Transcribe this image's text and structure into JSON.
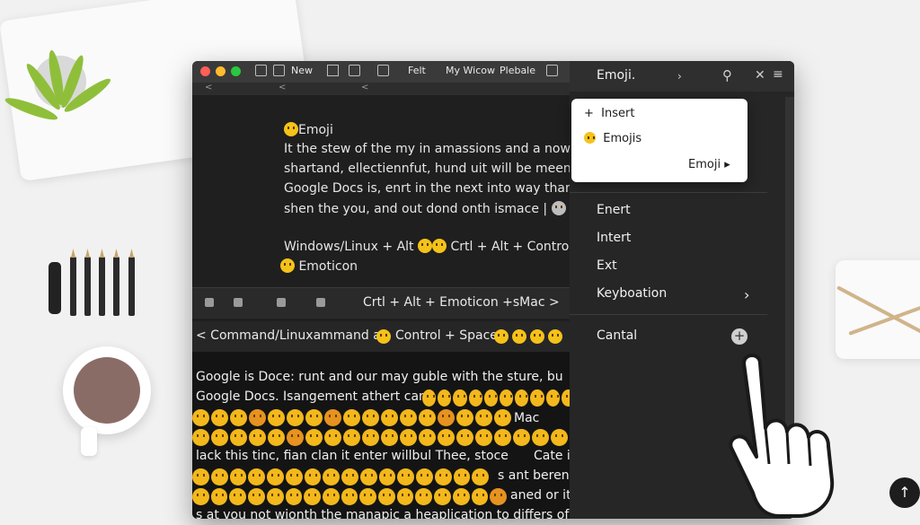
{
  "window": {
    "tabs": [
      "New",
      "Felt",
      "My Wicow",
      "Plebale"
    ],
    "ruler_marks": [
      "<",
      "<",
      "<"
    ]
  },
  "document": {
    "lines": [
      "Emoji",
      "It the stew of the my in amassions and a now on",
      "shartand, ellectiennfut, hund uit will be meenc",
      "Google Docs is, enrt in the next into way than, ybi",
      "shen the you, and out dond onth ismace |",
      "Windows/Linux + Alt",
      "Crtl + Alt + Contro",
      "Emoticon"
    ]
  },
  "toolbar2": {
    "label": "Crtl + Alt + Emoticon +sMac >"
  },
  "band": {
    "label_a": "< Command/Linuxammand at",
    "label_b": "Control + Space"
  },
  "lower": {
    "lines": [
      "Google is Doce: runt and our may guble with the sture, bu",
      "Google Docs. Isangement athert can",
      "Mac",
      "lack this tinc, fian clan it enter willbul Thee, stoce",
      "Cate it",
      "s ant berent",
      "aned or it",
      "s at vou not wionth the manapic a heaplication to differs of Bwe you"
    ]
  },
  "panel": {
    "title": "Emoji.",
    "popup": {
      "insert": "Insert",
      "emojis": "Emojis",
      "emoji": "Emoji"
    },
    "menu": [
      "Enert",
      "Intert",
      "Ext",
      "Keyboation",
      "Cantal"
    ]
  },
  "colors": {
    "accent": "#f5c21a",
    "window_bg": "#1f1f1f",
    "panel_bg": "#262626"
  }
}
